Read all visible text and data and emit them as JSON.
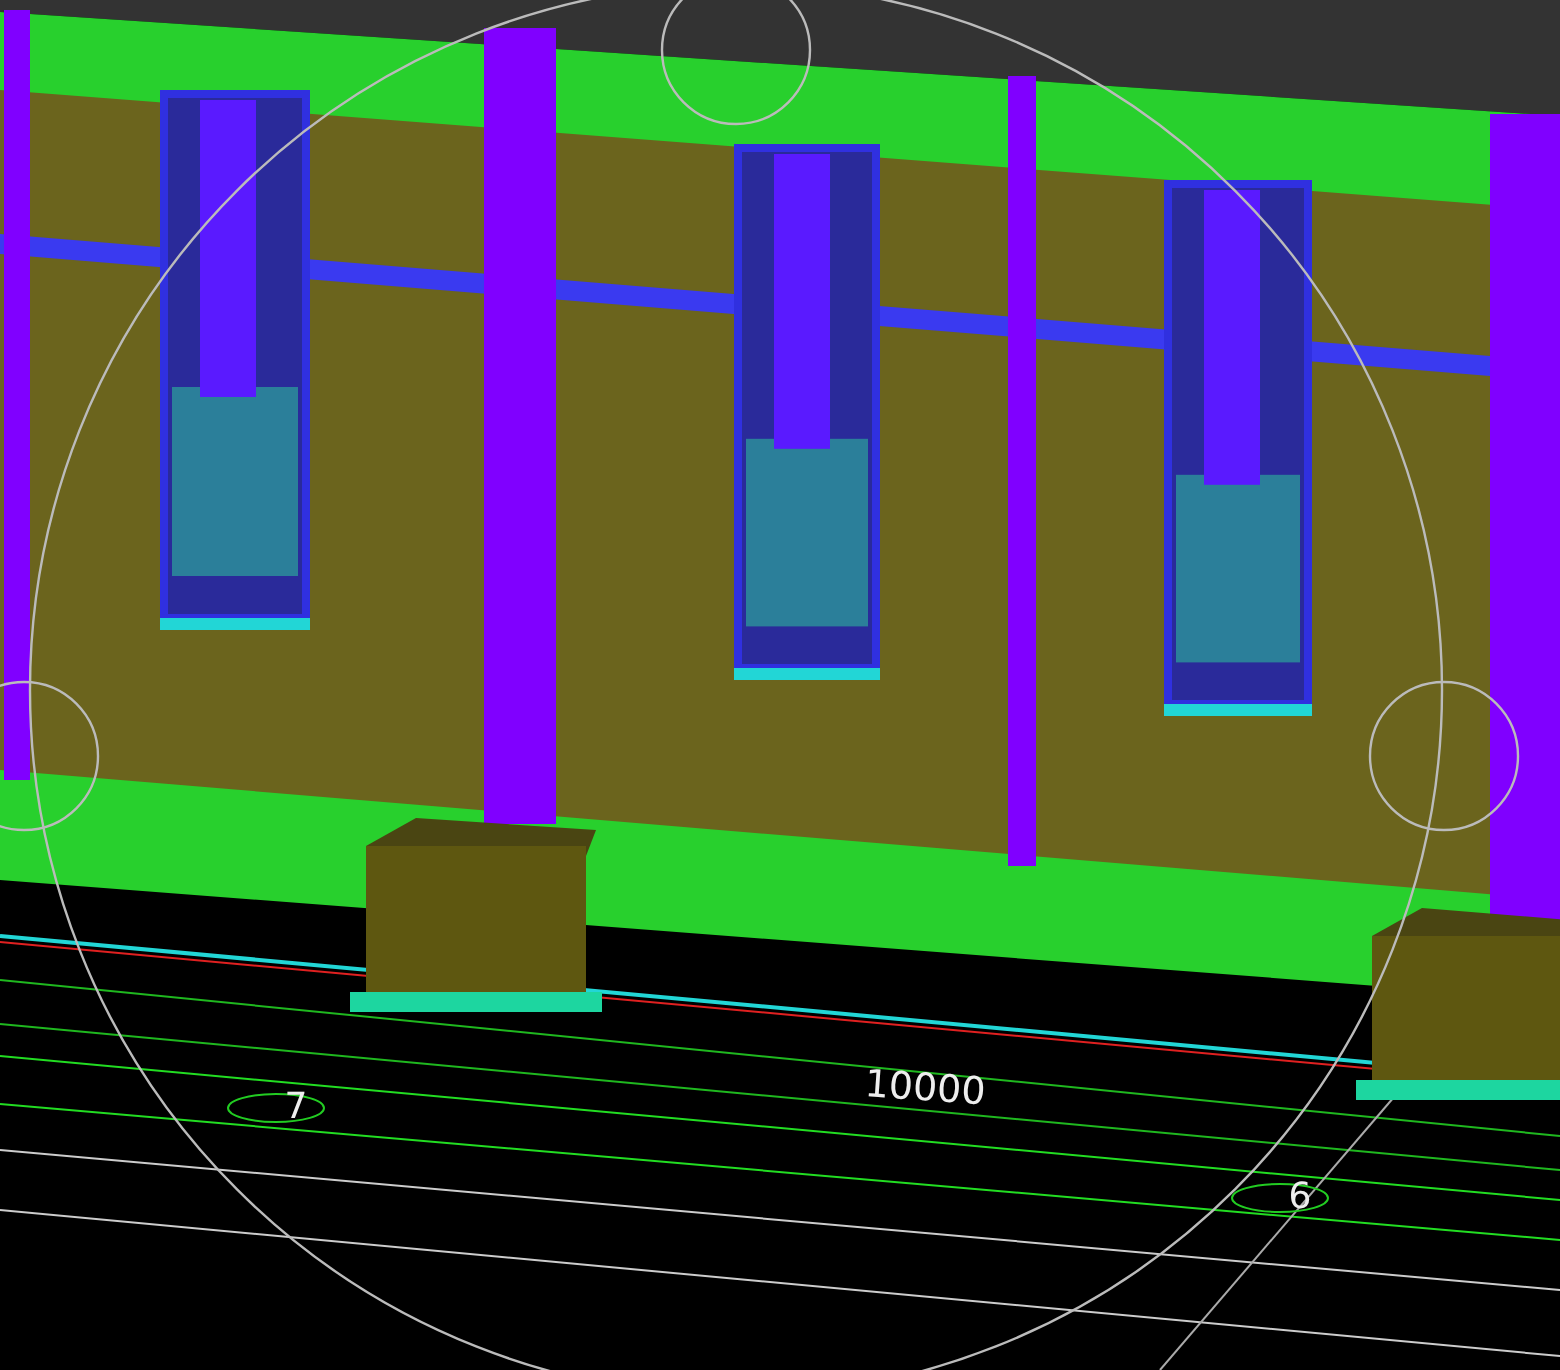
{
  "viewport": {
    "dimension": "10000",
    "grid_markers": [
      {
        "label": "7"
      },
      {
        "label": "6"
      }
    ]
  }
}
